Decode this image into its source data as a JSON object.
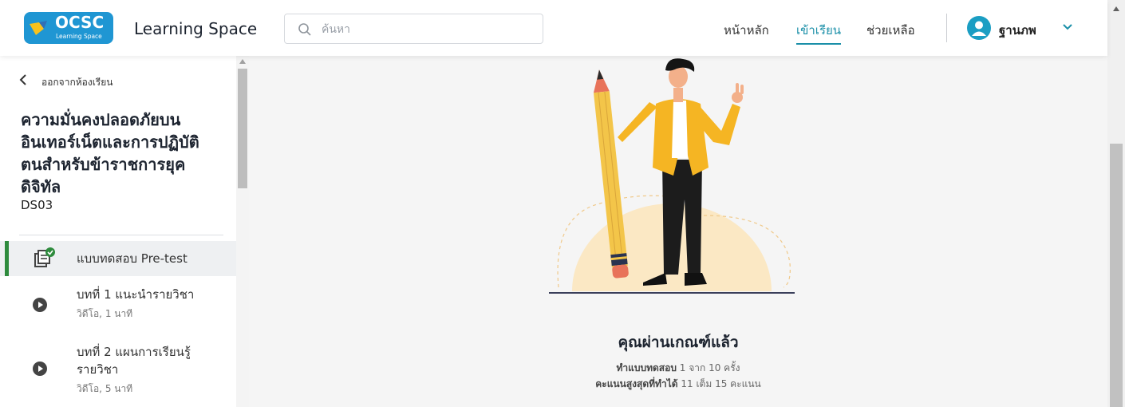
{
  "header": {
    "logo_text": "OCSC",
    "logo_subtext": "Learning Space",
    "app_title": "Learning Space",
    "search_placeholder": "ค้นหา",
    "nav": [
      "หน้าหลัก",
      "เข้าเรียน",
      "ช่วยเหลือ"
    ],
    "active_nav": "เข้าเรียน",
    "user_name": "ฐานภพ"
  },
  "sidebar": {
    "back_label": "ออกจากห้องเรียน",
    "course_title": "ความมั่นคงปลอดภัยบนอินเทอร์เน็ตและการปฏิบัติตนสำหรับข้าราชการยุคดิจิทัล",
    "course_code": "DS03",
    "lessons": [
      {
        "title": "แบบทดสอบ Pre-test",
        "meta": "",
        "icon": "quiz-check-icon",
        "completed": true
      },
      {
        "title": "บทที่ 1 แนะนำรายวิชา",
        "meta": "วิดีโอ, 1 นาที",
        "icon": "play-icon"
      },
      {
        "title": "บทที่ 2 แผนการเรียนรู้รายวิชา",
        "meta": "วิดีโอ, 5 นาที",
        "icon": "play-icon"
      }
    ]
  },
  "main": {
    "result_title": "คุณผ่านเกณฑ์แล้ว",
    "attempt_label": "ทำแบบทดสอบ",
    "attempt_value": "1 จาก 10 ครั้ง",
    "score_label": "คะแนนสูงสุดที่ทำได้",
    "score_value": "11 เต็ม 15 คะแนน"
  },
  "colors": {
    "accent": "#1a8fa8",
    "logo_bg": "#1f96d3",
    "active_bar": "#2e8b3d",
    "jacket": "#f5b523",
    "pencil": "#f3c549"
  }
}
